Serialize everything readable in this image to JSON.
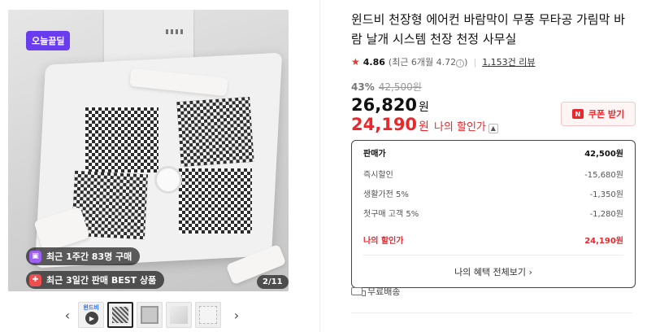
{
  "gallery": {
    "deal_badge": "오늘끝딜",
    "stats": [
      {
        "icon": "shopping-bag-icon",
        "text": "최근 1주간 83명 구매"
      },
      {
        "icon": "gift-icon",
        "text": "최근 3일간 판매 BEST 상품"
      }
    ],
    "page_counter": "2/11",
    "thumb_video_label": "윈드비",
    "thumbnails_count": 5
  },
  "product": {
    "title": "윈드비 천장형 에어컨 바람막이 무풍 무타공 가림막 바람 날개 시스템 천장 천정 사무실",
    "rating": "4.86",
    "rating_recent": "(최근 6개월 4.72",
    "rating_recent_close": ")",
    "reviews": "1,153건 리뷰",
    "discount_pct": "43%",
    "original_price": "42,500원",
    "price": "26,820",
    "price_unit": "원",
    "my_price": "24,190",
    "my_price_unit": "원",
    "my_price_label": "나의 할인가",
    "coupon_label": "쿠폰 받기"
  },
  "breakdown": {
    "rows": [
      {
        "label": "판매가",
        "value": "42,500원"
      },
      {
        "label": "즉시할인",
        "value": "-15,680원"
      },
      {
        "label": "생활가전 5%",
        "value": "-1,350원"
      },
      {
        "label": "첫구매 고객 5%",
        "value": "-1,280원"
      }
    ],
    "my_label": "나의 할인가",
    "my_value": "24,190원",
    "all_benefits": "나의 혜택 전체보기 ›"
  },
  "shipping": {
    "label": "무료배송"
  },
  "colors": {
    "accent_red": "#e8282d",
    "deal_purple": "#6a3cf0"
  }
}
